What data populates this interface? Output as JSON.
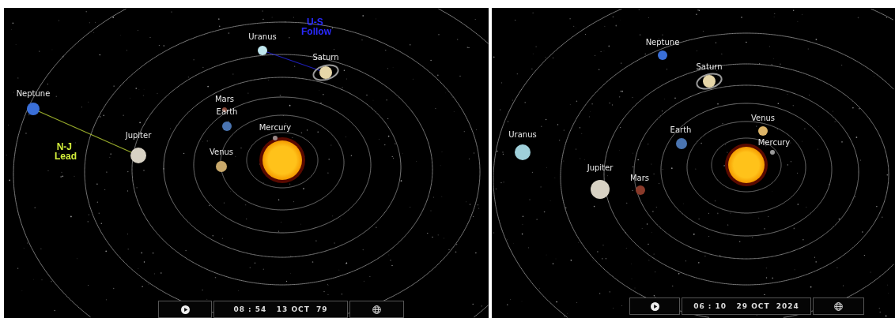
{
  "panels": [
    {
      "annotations": [
        {
          "text": "U-S Follow",
          "color": "#2a2aff"
        },
        {
          "text": "N-J Lead",
          "color": "#d4f03c"
        }
      ],
      "planets": [
        {
          "name": "Uranus",
          "color": "#bfe6ee"
        },
        {
          "name": "Saturn",
          "color": "#e6d6a8"
        },
        {
          "name": "Neptune",
          "color": "#3a6fd8"
        },
        {
          "name": "Mars",
          "color": "#8a4a3a"
        },
        {
          "name": "Earth",
          "color": "#4a74b0"
        },
        {
          "name": "Mercury",
          "color": "#9a8888"
        },
        {
          "name": "Jupiter",
          "color": "#d8d2c4"
        },
        {
          "name": "Venus",
          "color": "#c8a86a"
        }
      ],
      "time": "08 : 54",
      "date": "13 OCT",
      "year": "79"
    },
    {
      "planets": [
        {
          "name": "Neptune",
          "color": "#3a6fd8"
        },
        {
          "name": "Saturn",
          "color": "#e6d6a8"
        },
        {
          "name": "Venus",
          "color": "#dcb468"
        },
        {
          "name": "Earth",
          "color": "#4a74b0"
        },
        {
          "name": "Uranus",
          "color": "#9fd0da"
        },
        {
          "name": "Mercury",
          "color": "#9a9a9a"
        },
        {
          "name": "Jupiter",
          "color": "#d8d2c4"
        },
        {
          "name": "Mars",
          "color": "#8a3a2a"
        }
      ],
      "time": "06 : 10",
      "date": "29 OCT",
      "year": "2024"
    }
  ]
}
